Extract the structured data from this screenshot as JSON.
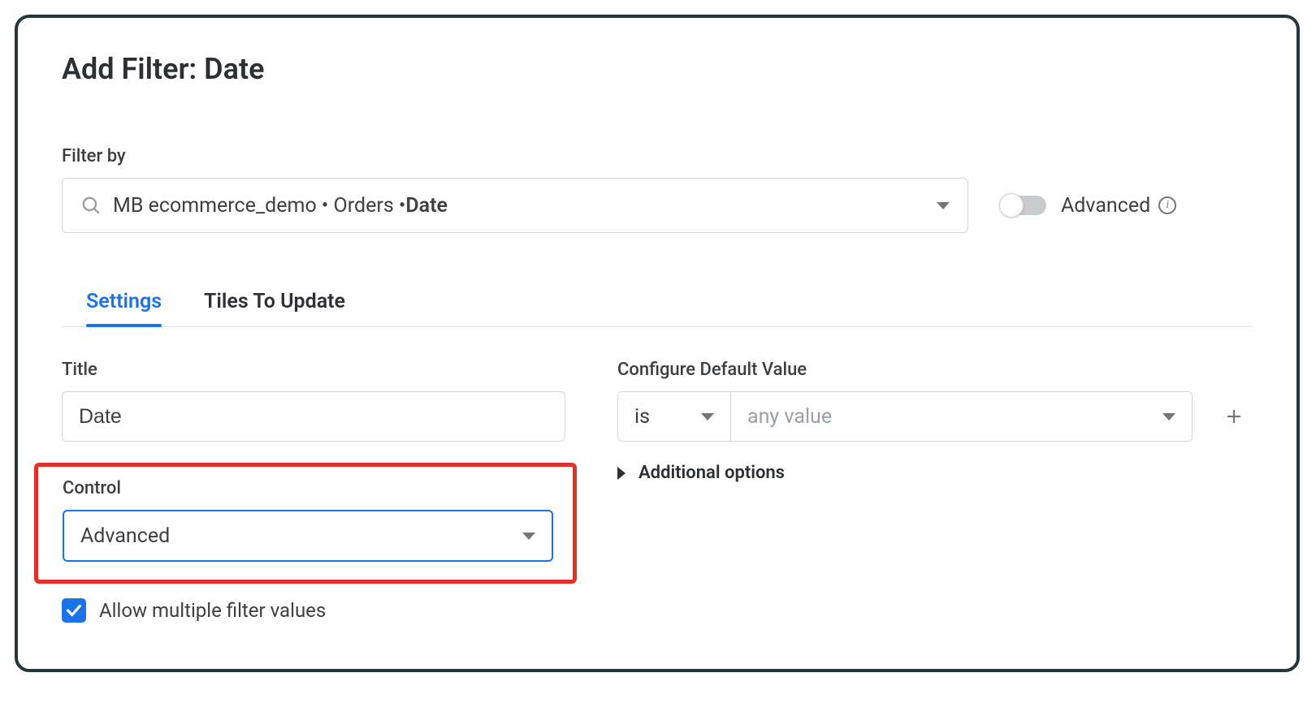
{
  "dialog": {
    "title": "Add Filter: Date"
  },
  "filter_by": {
    "label": "Filter by",
    "path_prefix": "MB ecommerce_demo • Orders • ",
    "path_field": "Date"
  },
  "advanced_toggle": {
    "label": "Advanced",
    "state": false
  },
  "tabs": {
    "settings": "Settings",
    "tiles": "Tiles To Update",
    "active": "settings"
  },
  "settings": {
    "title_label": "Title",
    "title_value": "Date",
    "control_label": "Control",
    "control_value": "Advanced",
    "allow_multiple_label": "Allow multiple filter values",
    "allow_multiple_checked": true
  },
  "default_value": {
    "label": "Configure Default Value",
    "operator": "is",
    "value_placeholder": "any value",
    "additional_label": "Additional options"
  }
}
